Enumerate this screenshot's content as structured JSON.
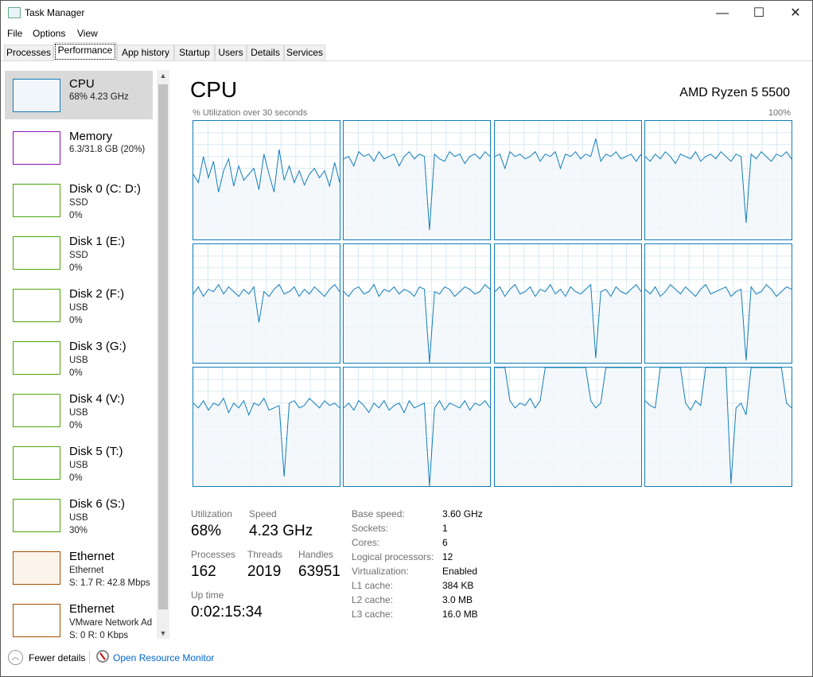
{
  "window": {
    "title": "Task Manager",
    "minimize": "—",
    "maximize": "☐",
    "close": "✕"
  },
  "menu": [
    "File",
    "Options",
    "View"
  ],
  "tabs": [
    "Processes",
    "Performance",
    "App history",
    "Startup",
    "Users",
    "Details",
    "Services"
  ],
  "active_tab": "Performance",
  "sidebar": [
    {
      "name": "CPU",
      "sub1": "68% 4.23 GHz",
      "color": "#117dbb",
      "fill": "#f1f6fa"
    },
    {
      "name": "Memory",
      "sub1": "6.3/31.8 GB (20%)",
      "color": "#8b12ae",
      "fill": "#fff"
    },
    {
      "name": "Disk 0 (C: D:)",
      "sub1": "SSD",
      "sub2": "0%",
      "color": "#4da60c",
      "fill": "#fff"
    },
    {
      "name": "Disk 1 (E:)",
      "sub1": "SSD",
      "sub2": "0%",
      "color": "#4da60c",
      "fill": "#fff"
    },
    {
      "name": "Disk 2 (F:)",
      "sub1": "USB",
      "sub2": "0%",
      "color": "#4da60c",
      "fill": "#fff"
    },
    {
      "name": "Disk 3 (G:)",
      "sub1": "USB",
      "sub2": "0%",
      "color": "#4da60c",
      "fill": "#fff"
    },
    {
      "name": "Disk 4 (V:)",
      "sub1": "USB",
      "sub2": "0%",
      "color": "#4da60c",
      "fill": "#fff"
    },
    {
      "name": "Disk 5 (T:)",
      "sub1": "USB",
      "sub2": "0%",
      "color": "#4da60c",
      "fill": "#fff"
    },
    {
      "name": "Disk 6 (S:)",
      "sub1": "USB",
      "sub2": "30%",
      "color": "#4da60c",
      "fill": "#fff"
    },
    {
      "name": "Ethernet",
      "sub1": "Ethernet",
      "sub2": "S: 1.7 R: 42.8 Mbps",
      "color": "#a74f01",
      "fill": "#fcf3eb"
    },
    {
      "name": "Ethernet",
      "sub1": "VMware Network Ad",
      "sub2": "S: 0 R: 0 Kbps",
      "color": "#a74f01",
      "fill": "#fff"
    }
  ],
  "main": {
    "title": "CPU",
    "model": "AMD Ryzen 5 5500",
    "caption": "% Utilization over 30 seconds",
    "max_label": "100%",
    "stats": {
      "utilization_label": "Utilization",
      "utilization": "68%",
      "speed_label": "Speed",
      "speed": "4.23 GHz",
      "processes_label": "Processes",
      "processes": "162",
      "threads_label": "Threads",
      "threads": "2019",
      "handles_label": "Handles",
      "handles": "63951",
      "uptime_label": "Up time",
      "uptime": "0:02:15:34"
    },
    "specs": [
      {
        "k": "Base speed:",
        "v": "3.60 GHz"
      },
      {
        "k": "Sockets:",
        "v": "1"
      },
      {
        "k": "Cores:",
        "v": "6"
      },
      {
        "k": "Logical processors:",
        "v": "12"
      },
      {
        "k": "Virtualization:",
        "v": "Enabled"
      },
      {
        "k": "L1 cache:",
        "v": "384 KB"
      },
      {
        "k": "L2 cache:",
        "v": "3.0 MB"
      },
      {
        "k": "L3 cache:",
        "v": "16.0 MB"
      }
    ]
  },
  "chart_data": {
    "type": "line",
    "title": "% Utilization over 30 seconds",
    "ylim": [
      0,
      100
    ],
    "series": [
      {
        "name": "CPU 0",
        "values": [
          55,
          48,
          70,
          52,
          66,
          40,
          58,
          68,
          45,
          62,
          50,
          55,
          60,
          42,
          72,
          55,
          40,
          76,
          50,
          62,
          48,
          58,
          46,
          55,
          60,
          52,
          58,
          45,
          65,
          48
        ]
      },
      {
        "name": "CPU 1",
        "values": [
          68,
          70,
          62,
          74,
          70,
          72,
          66,
          74,
          68,
          70,
          72,
          62,
          70,
          74,
          68,
          72,
          70,
          8,
          72,
          68,
          66,
          74,
          70,
          72,
          64,
          70,
          72,
          68,
          74,
          70
        ]
      },
      {
        "name": "CPU 2",
        "values": [
          70,
          72,
          60,
          74,
          70,
          72,
          68,
          70,
          74,
          66,
          72,
          70,
          74,
          60,
          72,
          70,
          74,
          68,
          72,
          70,
          85,
          66,
          72,
          70,
          74,
          68,
          70,
          72,
          66,
          72
        ]
      },
      {
        "name": "CPU 3",
        "values": [
          70,
          66,
          72,
          68,
          74,
          70,
          64,
          72,
          70,
          68,
          74,
          66,
          70,
          72,
          68,
          74,
          70,
          66,
          72,
          70,
          14,
          72,
          68,
          74,
          70,
          66,
          72,
          70,
          74,
          68
        ]
      },
      {
        "name": "CPU 4",
        "values": [
          58,
          64,
          56,
          62,
          60,
          66,
          58,
          64,
          60,
          56,
          62,
          58,
          64,
          34,
          60,
          56,
          62,
          66,
          58,
          60,
          64,
          56,
          62,
          58,
          64,
          60,
          56,
          62,
          66,
          60
        ]
      },
      {
        "name": "CPU 5",
        "values": [
          60,
          56,
          62,
          64,
          58,
          60,
          66,
          56,
          62,
          60,
          64,
          58,
          62,
          60,
          56,
          64,
          62,
          0,
          60,
          58,
          64,
          62,
          56,
          60,
          64,
          62,
          58,
          60,
          66,
          62
        ]
      },
      {
        "name": "CPU 6",
        "values": [
          60,
          64,
          56,
          62,
          66,
          58,
          60,
          64,
          56,
          62,
          60,
          66,
          58,
          62,
          56,
          64,
          60,
          58,
          62,
          66,
          4,
          60,
          62,
          56,
          64,
          60,
          58,
          62,
          66,
          60
        ]
      },
      {
        "name": "CPU 7",
        "values": [
          62,
          58,
          64,
          56,
          60,
          66,
          62,
          58,
          64,
          60,
          56,
          62,
          66,
          58,
          60,
          62,
          64,
          56,
          60,
          62,
          2,
          64,
          58,
          60,
          66,
          62,
          56,
          60,
          64,
          62
        ]
      },
      {
        "name": "CPU 8",
        "values": [
          70,
          66,
          72,
          64,
          70,
          68,
          74,
          62,
          70,
          66,
          72,
          60,
          70,
          68,
          74,
          64,
          66,
          68,
          8,
          70,
          72,
          66,
          68,
          74,
          70,
          66,
          72,
          68,
          70,
          66
        ]
      },
      {
        "name": "CPU 9",
        "values": [
          66,
          70,
          64,
          72,
          68,
          62,
          70,
          66,
          72,
          64,
          68,
          70,
          62,
          72,
          66,
          68,
          70,
          0,
          66,
          72,
          64,
          70,
          68,
          66,
          72,
          64,
          70,
          68,
          72,
          66
        ]
      },
      {
        "name": "CPU 10",
        "values": [
          100,
          100,
          100,
          72,
          66,
          70,
          68,
          74,
          66,
          72,
          100,
          100,
          100,
          100,
          100,
          100,
          100,
          100,
          100,
          72,
          66,
          70,
          100,
          100,
          100,
          100,
          100,
          100,
          100,
          100
        ]
      },
      {
        "name": "CPU 11",
        "values": [
          72,
          68,
          66,
          100,
          100,
          100,
          100,
          100,
          70,
          64,
          72,
          68,
          100,
          100,
          100,
          100,
          100,
          2,
          66,
          70,
          60,
          100,
          100,
          100,
          100,
          100,
          100,
          100,
          70,
          66
        ]
      }
    ]
  }
}
